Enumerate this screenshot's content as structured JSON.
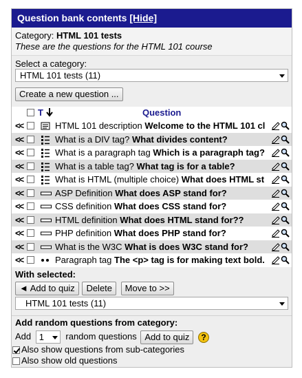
{
  "header": {
    "title": "Question bank contents",
    "hide_link": "[Hide]"
  },
  "category_info": {
    "label": "Category:",
    "name": "HTML 101 tests",
    "description": "These are the questions for the HTML 101 course"
  },
  "select_category": {
    "label": "Select a category:",
    "value": "HTML 101 tests (11)"
  },
  "create_button": "Create a new question ...",
  "table": {
    "col_type": "T",
    "col_question": "Question"
  },
  "questions": [
    {
      "type": "description",
      "name": "HTML 101 description",
      "text": "Welcome to the HTML 101 cl"
    },
    {
      "type": "multichoice",
      "name": "What is a DIV tag?",
      "text": "What divides content?"
    },
    {
      "type": "multichoice",
      "name": "What is a paragraph tag",
      "text": "Which is a paragraph tag?"
    },
    {
      "type": "multichoice",
      "name": "What is a table tag?",
      "text": "What tag is for a table?"
    },
    {
      "type": "multichoice",
      "name": "What is HTML (multiple choice)",
      "text": "What does HTML st"
    },
    {
      "type": "shortanswer",
      "name": "ASP Definition",
      "text": "What does ASP stand for?"
    },
    {
      "type": "shortanswer",
      "name": "CSS definition",
      "text": "What does CSS stand for?"
    },
    {
      "type": "shortanswer",
      "name": "HTML definition",
      "text": "What does HTML stand for??"
    },
    {
      "type": "shortanswer",
      "name": "PHP definition",
      "text": "What does PHP stand for?"
    },
    {
      "type": "shortanswer",
      "name": "What is the W3C",
      "text": "What is does W3C stand for?"
    },
    {
      "type": "cloze",
      "name": "Paragraph tag",
      "text": "The <p> tag is for making text bold."
    }
  ],
  "with_selected": {
    "label": "With selected:",
    "add_to_quiz": "◄ Add to quiz",
    "delete": "Delete",
    "move_to": "Move to >>",
    "target_category": "HTML 101 tests (11)"
  },
  "random": {
    "label": "Add random questions from category:",
    "add_word": "Add",
    "count": "1",
    "suffix": "random questions",
    "button": "Add to quiz",
    "help": "?"
  },
  "options": {
    "subcategories": "Also show questions from sub-categories",
    "old": "Also show old questions"
  },
  "colors": {
    "header_bg": "#1b1b8f",
    "panel_bg": "#eeeeee",
    "row_alt": "#dedede"
  }
}
